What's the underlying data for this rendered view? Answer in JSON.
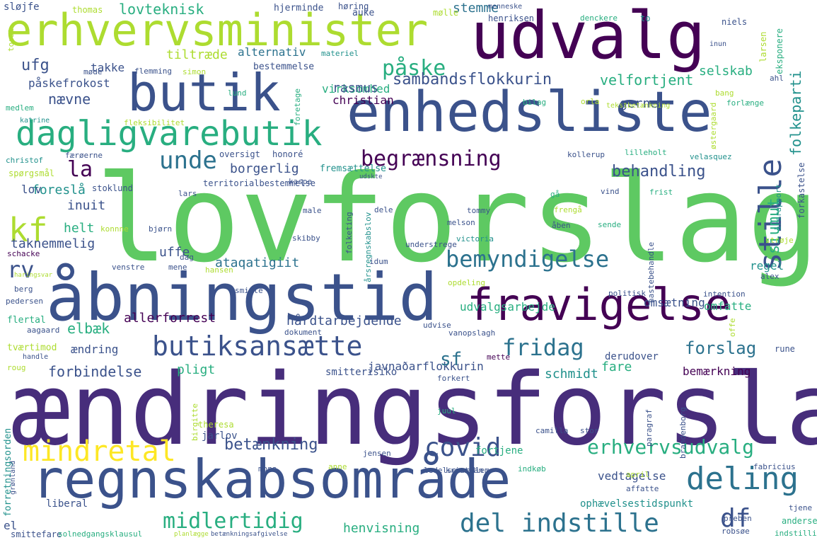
{
  "palette": {
    "dark_purple": "#440154",
    "purple": "#472d7b",
    "indigo": "#3b528b",
    "blue": "#2c728e",
    "teal": "#21918c",
    "sea_green": "#28ae80",
    "green": "#5ec962",
    "lime": "#addc30",
    "yellow": "#fde725"
  },
  "words": [
    "lovforslag",
    "ændringsforslag",
    "regnskabsområde",
    "åbningstid",
    "enhedsliste",
    "udvalg",
    "erhvervsminister",
    "butik",
    "fravigelse",
    "dagligvarebutik",
    "butiksansætte",
    "mindretal",
    "deling",
    "del indstille",
    "bemyndigelse",
    "covid",
    "begrænsning",
    "kf",
    "rv",
    "stille",
    "fridag",
    "midlertidig",
    "påske",
    "unde",
    "erhvervsudvalg",
    "df",
    "sambandsflokkurin",
    "la",
    "forslag",
    "behandling",
    "lovteknisk",
    "betænkning",
    "forbindelse",
    "ufg",
    "nævne",
    "velfortjent",
    "siumut",
    "virksomhed",
    "folkeparti",
    "selskab",
    "hårdtarbejdende",
    "ataqatigiit",
    "allerforrest",
    "udvalgsarbejde",
    "javnaðarflokkurin",
    "borgerlig",
    "stemme",
    "påskefrokost",
    "takke",
    "tiltræde",
    "alternativ",
    "elbæk",
    "christian",
    "rasmus",
    "schmidt",
    "fare",
    "pligt",
    "henvisning",
    "taknemmelig",
    "gerne",
    "inuit",
    "helt",
    "uffe",
    "sf",
    "regel",
    "omfatte",
    "bemærkning",
    "ændring",
    "omsætning",
    "foreslå",
    "lov",
    "el",
    "liberal",
    "fortjene",
    "vedtagelse",
    "ophævelsestidspunkt",
    "forretningsorden",
    "theresa",
    "jarlov",
    "derudover",
    "smitterisiko",
    "fremsættelse",
    "territorialbestemmelse",
    "oversigt",
    "honoré",
    "bestemmelse",
    "sløjfe",
    "thomas",
    "hjerminde",
    "høring",
    "auke",
    "mølle",
    "menneske",
    "henriksen",
    "denckere",
    "to",
    "niels",
    "torst",
    "materiel",
    "larsen",
    "eksponere",
    "inun",
    "møde",
    "flemming",
    "simon",
    "ahl",
    "medlem",
    "lund",
    "foretage",
    "bilag",
    "orla",
    "bang",
    "forlænge",
    "katrine",
    "fleksibilitet",
    "tekstbetænkning",
    "østergaard",
    "christof",
    "færøerne",
    "kollerup",
    "lilleholt",
    "velasquez",
    "spørgsmål",
    "stoklund",
    "lars",
    "kaspe",
    "gå",
    "vind",
    "frist",
    "forkastelse",
    "årsrapport",
    "hastebehandle",
    "konnne",
    "bjørn",
    "tommy",
    "melson",
    "victoria",
    "åben",
    "sende",
    "strøje",
    "male",
    "dele",
    "frengå",
    "skibby",
    "folketing",
    "årsregnskabslov",
    "understrege",
    "idum",
    "schacke",
    "dag",
    "venstre",
    "mene",
    "hansen",
    "berg",
    "smitte",
    "opdeling",
    "politisk",
    "intention",
    "alex",
    "pedersen",
    "flertal",
    "aagaard",
    "dokument",
    "udvise",
    "vanopslagh",
    "offe",
    "tværtimod",
    "rune",
    "mette",
    "forkert",
    "roug",
    "handle",
    "paragraf",
    "brandenborg",
    "birgitte",
    "camilla",
    "juul",
    "stor",
    "mona",
    "anne",
    "jensen",
    "ledelsesmedlem",
    "kristian",
    "indkøb",
    "april",
    "fabricius",
    "affatte",
    "grønland",
    "preben",
    "andersen",
    "tjene",
    "robsøe",
    "indstilling",
    "smittefare",
    "solnedgangsklausul",
    "planlægge",
    "betænkningsafgivelse",
    "haringsvar",
    "udskte"
  ]
}
